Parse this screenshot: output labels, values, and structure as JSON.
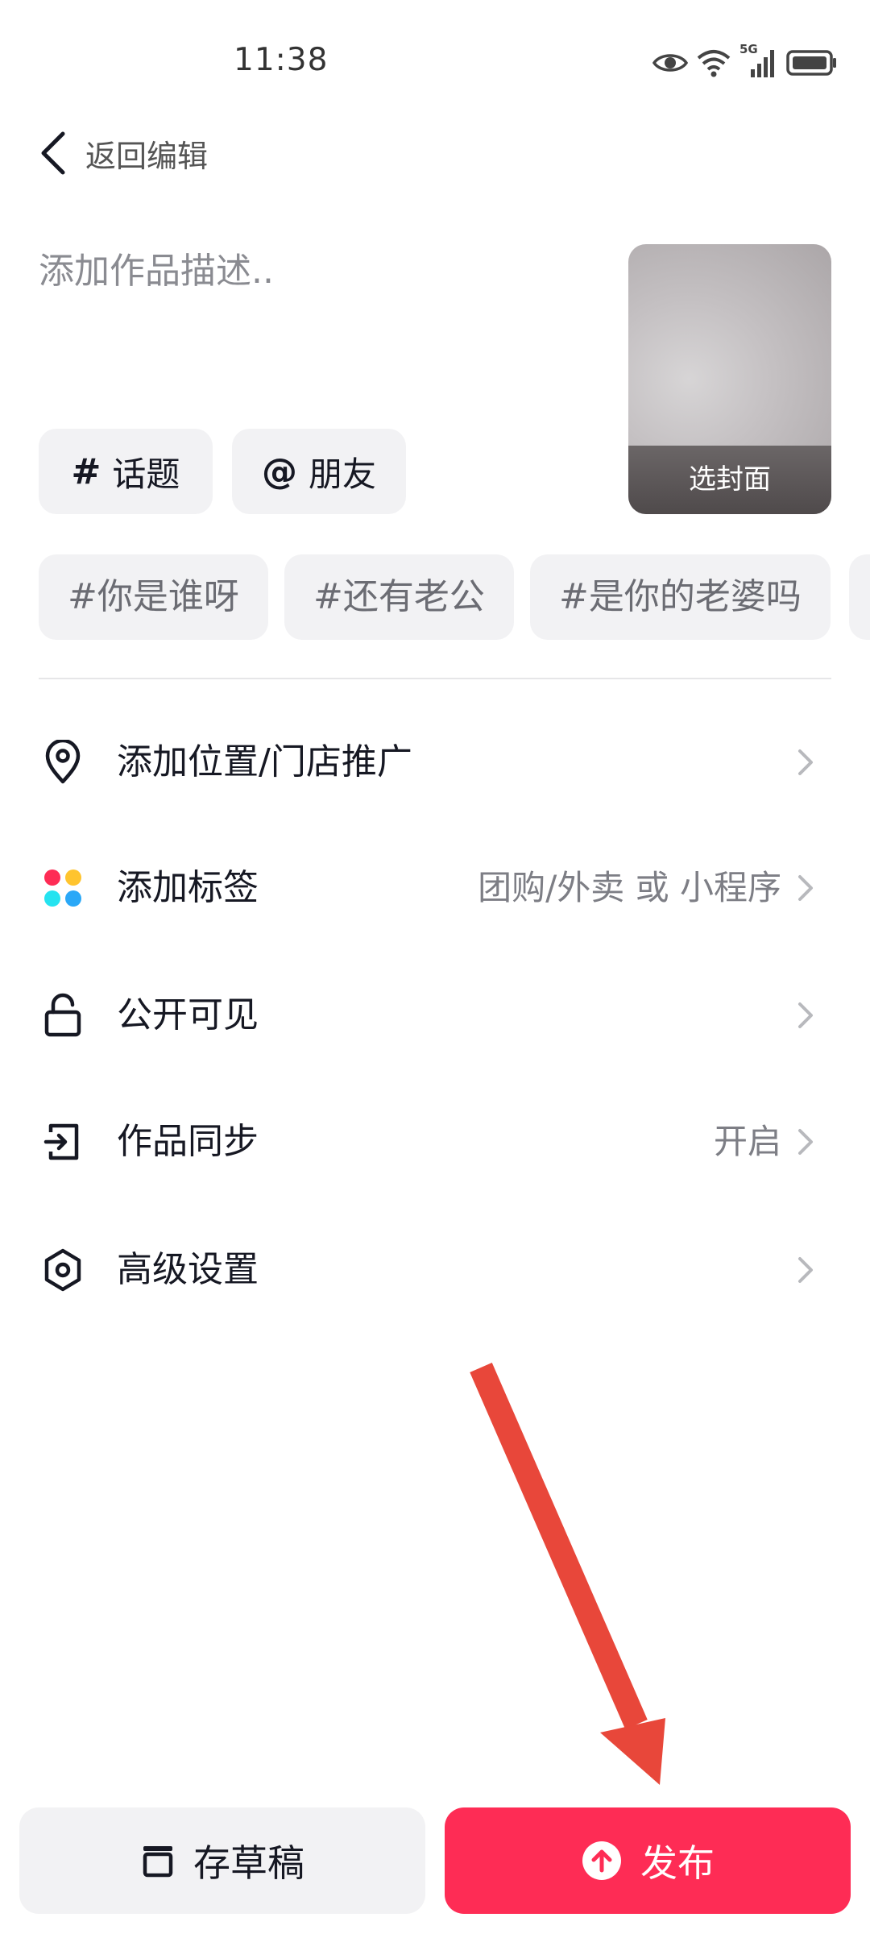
{
  "status_bar": {
    "time": "11:38",
    "network": "5G"
  },
  "header": {
    "back_label": "返回编辑"
  },
  "description": {
    "placeholder": "添加作品描述.."
  },
  "cover": {
    "label": "选封面"
  },
  "chips": [
    {
      "symbol": "#",
      "label": "话题"
    },
    {
      "symbol": "@",
      "label": "朋友"
    }
  ],
  "suggested_tags": [
    "#你是谁呀",
    "#还有老公",
    "#是你的老婆吗"
  ],
  "settings": [
    {
      "label": "添加位置/门店推广",
      "value": "",
      "icon": "location-pin-icon"
    },
    {
      "label": "添加标签",
      "value": "团购/外卖 或 小程序",
      "icon": "color-dots-icon"
    },
    {
      "label": "公开可见",
      "value": "",
      "icon": "unlock-icon"
    },
    {
      "label": "作品同步",
      "value": "开启",
      "icon": "sync-exit-icon"
    },
    {
      "label": "高级设置",
      "value": "",
      "icon": "hexagon-settings-icon"
    }
  ],
  "buttons": {
    "draft": "存草稿",
    "publish": "发布"
  },
  "colors": {
    "accent": "#fe2c55",
    "annotation_arrow": "#e8473a",
    "chip_bg": "#f2f2f4"
  }
}
